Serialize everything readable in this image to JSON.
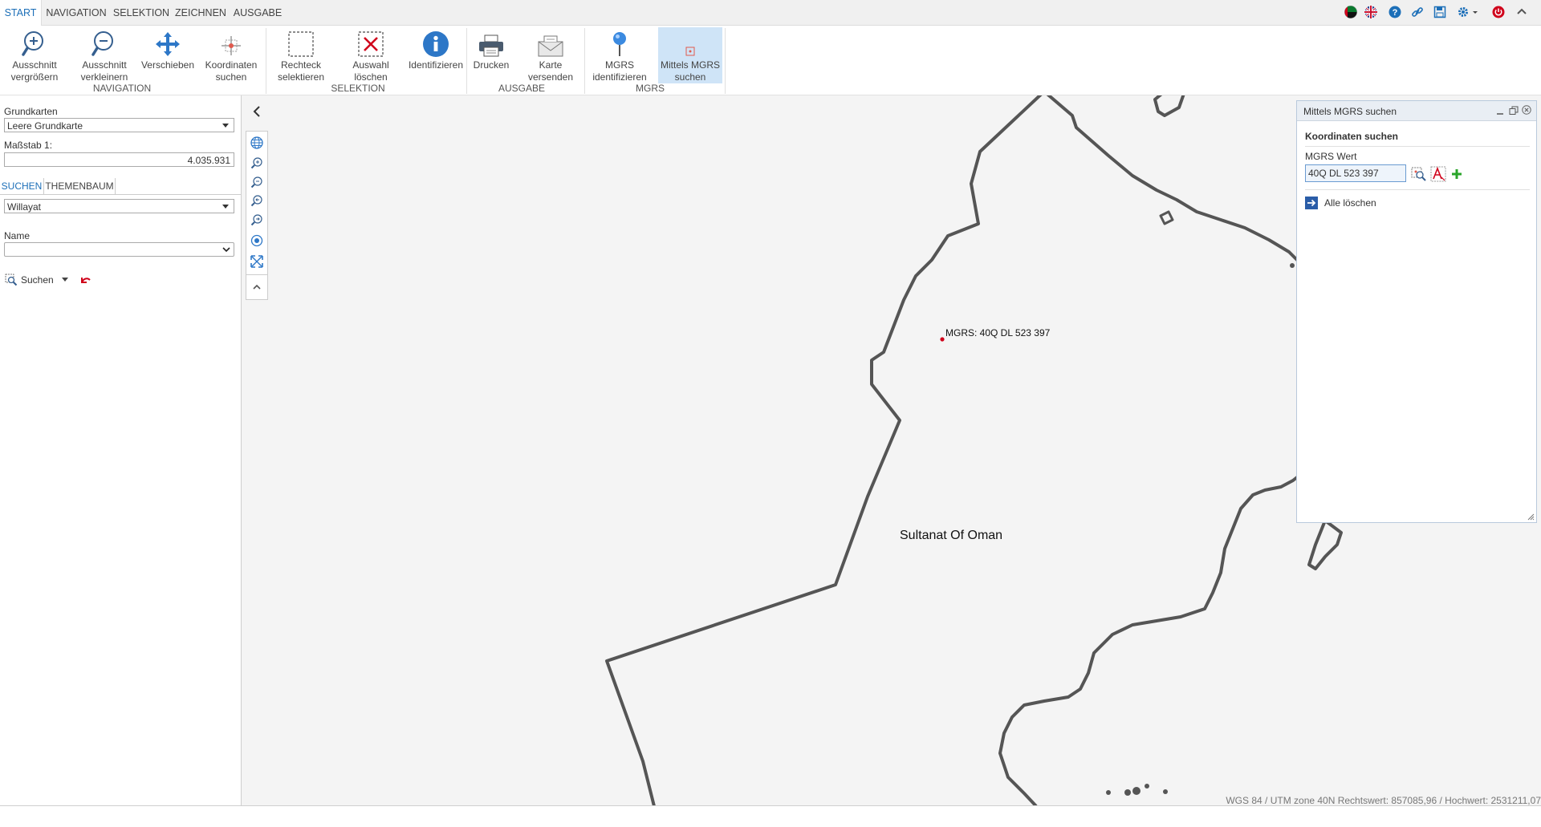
{
  "tabs": [
    "START",
    "NAVIGATION",
    "SELEKTION",
    "ZEICHNEN",
    "AUSGABE"
  ],
  "ribbon": {
    "buttons": [
      {
        "line1": "Ausschnitt",
        "line2": "vergrößern"
      },
      {
        "line1": "Ausschnitt",
        "line2": "verkleinern"
      },
      {
        "line1": "Verschieben",
        "line2": ""
      },
      {
        "line1": "Koordinaten",
        "line2": "suchen"
      },
      {
        "line1": "Rechteck",
        "line2": "selektieren"
      },
      {
        "line1": "Auswahl",
        "line2": "löschen"
      },
      {
        "line1": "Identifizieren",
        "line2": ""
      },
      {
        "line1": "Drucken",
        "line2": ""
      },
      {
        "line1": "Karte",
        "line2": "versenden"
      },
      {
        "line1": "MGRS",
        "line2": "identifizieren"
      },
      {
        "line1": "Mittels MGRS",
        "line2": "suchen"
      }
    ],
    "groups": [
      "NAVIGATION",
      "SELEKTION",
      "AUSGABE",
      "MGRS"
    ]
  },
  "left": {
    "basemap_label": "Grundkarten",
    "basemap_value": "Leere Grundkarte",
    "scale_label": "Maßstab 1:",
    "scale_value": "4.035.931",
    "tab_search": "SUCHEN",
    "tab_tree": "THEMENBAUM",
    "layer_value": "Willayat",
    "name_label": "Name",
    "name_value": "",
    "search_button": "Suchen"
  },
  "map": {
    "country_label": "Sultanat Of Oman",
    "marker_label": "MGRS: 40Q DL 523 397",
    "marker_color": "#d0021b"
  },
  "mgrs_panel": {
    "title": "Mittels MGRS suchen",
    "section": "Koordinaten suchen",
    "field_label": "MGRS Wert",
    "field_value": "40Q DL 523 397",
    "clear_all": "Alle löschen"
  },
  "status": "WGS 84 / UTM zone 40N Rechtswert: 857085,96 / Hochwert: 2531211,07",
  "colors": {
    "accent": "#1c6fb8",
    "selected": "#cfe4f7",
    "map_bg": "#f4f4f4"
  }
}
